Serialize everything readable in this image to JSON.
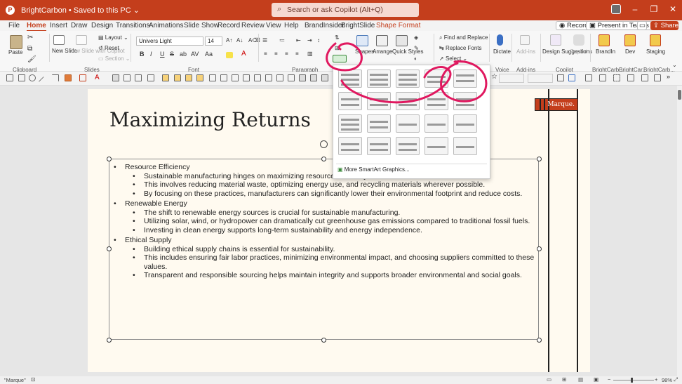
{
  "titlebar": {
    "doc_title": "BrightCarbon • Saved to this PC ⌄",
    "search_placeholder": "Search or ask Copilot (Alt+Q)",
    "minimize": "–",
    "restore": "❐",
    "close": "✕"
  },
  "tabs": [
    "File",
    "Home",
    "Insert",
    "Draw",
    "Design",
    "Transitions",
    "Animations",
    "Slide Show",
    "Record",
    "Review",
    "View",
    "Help",
    "BrandInsider",
    "BrightSlide",
    "Shape Format"
  ],
  "right_buttons": {
    "record": "Record",
    "present_teams": "Present in Teams",
    "share": "Share"
  },
  "ribbon": {
    "clipboard": {
      "paste": "Paste",
      "group": "Clipboard"
    },
    "slides": {
      "new_slide": "New Slide",
      "new_slide_copilot": "New Slide with Copilot",
      "layout": "Layout ⌄",
      "reset": "Reset",
      "section": "Section ⌄",
      "group": "Slides"
    },
    "font": {
      "name": "Univers Light",
      "size": "14",
      "bold": "B",
      "italic": "I",
      "underline": "U",
      "strike": "S",
      "group": "Font"
    },
    "paragraph": {
      "group": "Paragraph"
    },
    "drawing": {
      "shapes": "Shapes",
      "arrange": "Arrange",
      "quick_styles": "Quick Styles"
    },
    "editing": {
      "find_replace": "Find and Replace",
      "replace_fonts": "Replace Fonts",
      "select": "Select ⌄"
    },
    "voice": {
      "dictate": "Dictate",
      "group": "Voice"
    },
    "addins": {
      "addins": "Add-ins",
      "group": "Add-ins"
    },
    "copilot": {
      "design_suggestions": "Design Suggestions",
      "copilot": "Copilot",
      "group": "Copilot"
    },
    "brand": {
      "brandin": "BrandIn",
      "dev": "Dev",
      "staging": "Staging",
      "group_brandin": "BrightCarb...",
      "group_dev": "BrightCar...",
      "group_staging": "BrightCarb..."
    }
  },
  "slide": {
    "title": "Maximizing Returns",
    "marque": "Marque.",
    "bullets": [
      {
        "text": "Resource Efficiency",
        "subs": [
          "Sustainable manufacturing hinges on maximizing resource efficiency.",
          "This involves reducing material waste, optimizing energy use, and recycling materials wherever possible.",
          "By focusing on these practices, manufacturers can significantly lower their environmental footprint and reduce costs."
        ]
      },
      {
        "text": "Renewable Energy",
        "subs": [
          "The shift to renewable energy sources is crucial for sustainable manufacturing.",
          "Utilizing solar, wind, or hydropower can dramatically cut greenhouse gas emissions compared to traditional fossil fuels.",
          "Investing in clean energy supports long-term sustainability and energy independence."
        ]
      },
      {
        "text": "Ethical Supply",
        "subs": [
          "Building ethical supply chains is essential for sustainability.",
          "This includes ensuring fair labor practices, minimizing environmental impact, and choosing suppliers committed to these values.",
          "Transparent and responsible sourcing helps maintain integrity and supports broader environmental and social goals."
        ]
      }
    ]
  },
  "smartart_menu": {
    "more": "More SmartArt Graphics..."
  },
  "status": {
    "left": "\"Marque\"",
    "zoom": "98%"
  },
  "colors": {
    "accent": "#c43e1c",
    "ink": "#e0185f"
  }
}
